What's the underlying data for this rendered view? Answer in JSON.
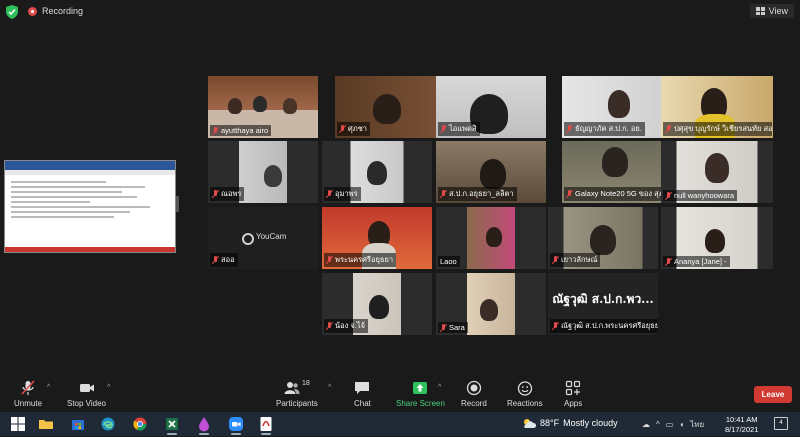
{
  "top": {
    "recording_label": "Recording",
    "view_label": "View"
  },
  "tiles": [
    {
      "name": "ayutthaya airo",
      "muted": true
    },
    {
      "name": "ศุภชา",
      "muted": true
    },
    {
      "name": "ไอแพดสิ",
      "muted": true
    },
    {
      "name": "ธัญญาภัค ส.ป.ก. อย.",
      "muted": true
    },
    {
      "name": "ปศุสุข บุญรักษ์ วิเชียรสนทัย สอส",
      "muted": true
    },
    {
      "name": "ณอพร",
      "muted": true
    },
    {
      "name": "อุมาพร",
      "muted": true
    },
    {
      "name": "ส.ป.ก.อยุธยา_ลลิตา",
      "muted": true
    },
    {
      "name": "Galaxy Note20 5G ของ สุภ...",
      "muted": true
    },
    {
      "name": "null wanyhoowara",
      "muted": true
    },
    {
      "name": "สออ",
      "muted": true
    },
    {
      "name": "พระนครศรีอยุธยา",
      "muted": true
    },
    {
      "name": "Laoo",
      "muted": false
    },
    {
      "name": "เยาวลักษณ์",
      "muted": true
    },
    {
      "name": "Ananya [Jane] -",
      "muted": true
    },
    {
      "name": "น้อง จ.ไจ้",
      "muted": true
    },
    {
      "name": "Sara",
      "muted": true
    },
    {
      "name": "ณัฐวุฒิ ส.ป.ก.พระนครศรีอยุธยา",
      "muted": true,
      "display_name": "ณัฐวุฒิ ส.ป.ก.พว..."
    }
  ],
  "youcam_label": "YouCam",
  "toolbar": {
    "unmute": "Unmute",
    "stop_video": "Stop Video",
    "participants": "Participants",
    "participants_count": "18",
    "chat": "Chat",
    "share_screen": "Share Screen",
    "record": "Record",
    "reactions": "Reactions",
    "apps": "Apps",
    "leave": "Leave"
  },
  "taskbar": {
    "temperature": "88°F",
    "weather": "Mostly cloudy",
    "language": "ไทย",
    "time": "10:41 AM",
    "date": "8/17/2021",
    "notifications": "4"
  },
  "colors": {
    "accent_green": "#4bd17d",
    "leave_red": "#d13a32",
    "active_speaker": "#d4e63a",
    "muted_red": "#e24b4b"
  }
}
